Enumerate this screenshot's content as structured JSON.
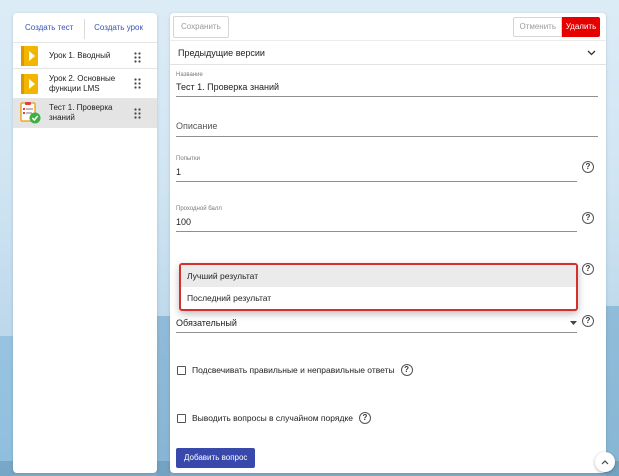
{
  "sidebar": {
    "create_test": "Создать тест",
    "create_lesson": "Создать урок",
    "items": [
      {
        "label": "Урок 1. Вводный",
        "type": "lesson"
      },
      {
        "label": "Урок 2. Основные функции LMS",
        "type": "lesson"
      },
      {
        "label": "Тест 1. Проверка знаний",
        "type": "test",
        "active": true
      }
    ]
  },
  "toolbar": {
    "save_label": "Сохранить",
    "cancel_label": "Отменить",
    "delete_label": "Удалить"
  },
  "versions": {
    "label": "Предыдущие версии"
  },
  "form": {
    "name": {
      "label": "Название",
      "value": "Тест 1. Проверка знаний"
    },
    "description": {
      "placeholder": "Описание"
    },
    "attempts": {
      "label": "Попытки",
      "value": "1"
    },
    "passing_score": {
      "label": "Проходной балл",
      "value": "100"
    },
    "result_select": {
      "options": [
        "Лучший результат",
        "Последний результат"
      ],
      "hovered": "Лучший результат"
    },
    "requirement_select": {
      "value": "Обязательный"
    },
    "highlight_answers": {
      "label": "Подсвечивать правильные и неправильные ответы",
      "checked": false
    },
    "random_order": {
      "label": "Выводить вопросы в случайном порядке",
      "checked": false
    },
    "add_question": "Добавить вопрос"
  },
  "colors": {
    "accent": "#3949ab",
    "danger": "#e60000",
    "link": "#3a54b4",
    "lesson_icon": "#f2b600",
    "success": "#3cb043"
  },
  "icons": {
    "help": "question-circle-icon",
    "drag": "drag-handle-icon",
    "chevron": "chevron-down-icon",
    "scroll": "chevron-up-icon"
  }
}
